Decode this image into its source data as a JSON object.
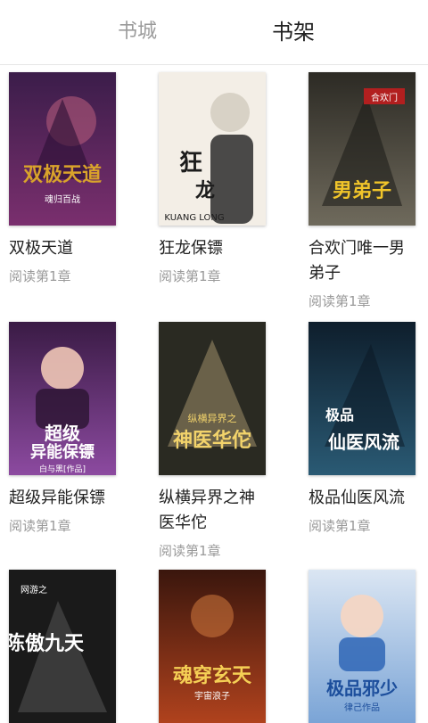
{
  "tabs": {
    "store": "书城",
    "shelf": "书架"
  },
  "books": [
    {
      "title": "双极天道",
      "progress": "阅读第1章",
      "cover_text": "双极天道",
      "cover_sub": "魂归百战",
      "colors": [
        "#3b1d4a",
        "#7a2f6e",
        "#d9a32b"
      ]
    },
    {
      "title": "狂龙保镖",
      "progress": "阅读第1章",
      "cover_text": "狂龙保镖",
      "cover_sub": "KUANG LONG",
      "colors": [
        "#f3eee6",
        "#d8d2c6",
        "#2b2b2b"
      ]
    },
    {
      "title": "合欢门唯一男弟子",
      "progress": "阅读第1章",
      "cover_text": "男弟子",
      "cover_sub": "合欢门",
      "colors": [
        "#2c2a24",
        "#6f6a5c",
        "#f1c52a"
      ]
    },
    {
      "title": "超级异能保镖",
      "progress": "阅读第1章",
      "cover_text": "超级异能保镖",
      "cover_sub": "白与黑[作品]",
      "colors": [
        "#3a1b45",
        "#8c4aa0",
        "#ffffff"
      ]
    },
    {
      "title": "纵横异界之神医华佗",
      "progress": "阅读第1章",
      "cover_text": "神医华佗",
      "cover_sub": "纵横异界之",
      "colors": [
        "#2a2a22",
        "#b7a37a",
        "#f2d36b"
      ]
    },
    {
      "title": "极品仙医风流",
      "progress": "阅读第1章",
      "cover_text": "仙医风流",
      "cover_sub": "极品",
      "colors": [
        "#0e1e2c",
        "#2a5a74",
        "#ffffff"
      ]
    },
    {
      "title": "",
      "progress": "",
      "cover_text": "陈傲九天",
      "cover_sub": "网游之",
      "colors": [
        "#1a1a1a",
        "#4b4b4b",
        "#ffffff"
      ]
    },
    {
      "title": "",
      "progress": "",
      "cover_text": "魂穿玄天",
      "cover_sub": "宇宙浪子",
      "colors": [
        "#3a160d",
        "#b0421d",
        "#f5cf55"
      ]
    },
    {
      "title": "",
      "progress": "",
      "cover_text": "极品邪少",
      "cover_sub": "律己作品",
      "colors": [
        "#dbe6f3",
        "#7aa4d6",
        "#1c4e9c"
      ]
    }
  ]
}
